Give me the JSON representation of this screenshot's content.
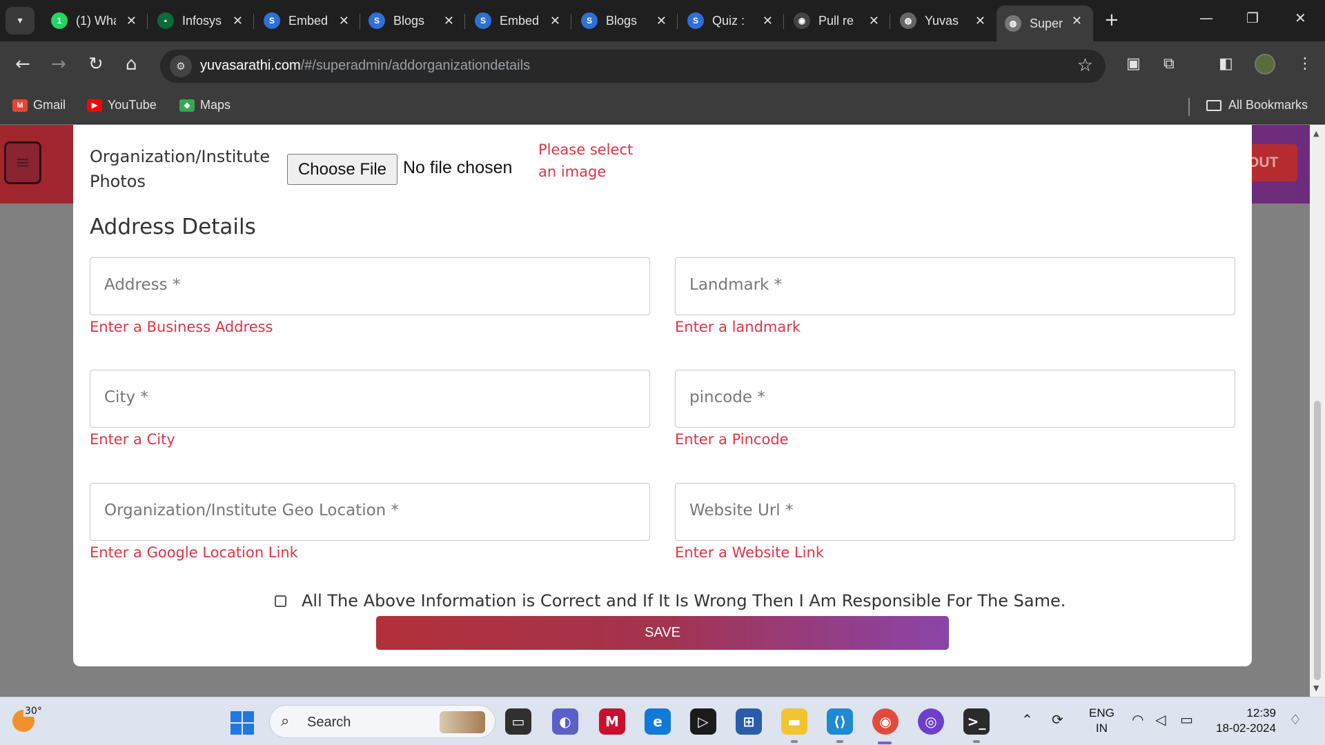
{
  "browser": {
    "tabs": [
      {
        "title": "(1) WhatsApp",
        "favicon": "whatsapp-icon",
        "color": "#25d366",
        "glyph": "1"
      },
      {
        "title": "Infosys",
        "favicon": "infosys-icon",
        "color": "#0b6b3a",
        "glyph": "▪"
      },
      {
        "title": "Embed",
        "favicon": "s-logo-icon",
        "color": "#2f6fd6",
        "glyph": "S"
      },
      {
        "title": "Blogs",
        "favicon": "s-logo-icon",
        "color": "#2f6fd6",
        "glyph": "S"
      },
      {
        "title": "Embed",
        "favicon": "s-logo-icon",
        "color": "#2f6fd6",
        "glyph": "S"
      },
      {
        "title": "Blogs",
        "favicon": "s-logo-icon",
        "color": "#2f6fd6",
        "glyph": "S"
      },
      {
        "title": "Quiz :",
        "favicon": "s-logo-icon",
        "color": "#2f6fd6",
        "glyph": "S"
      },
      {
        "title": "Pull re",
        "favicon": "github-icon",
        "color": "#444444",
        "glyph": "◉"
      },
      {
        "title": "Yuvas",
        "favicon": "globe-icon",
        "color": "#666666",
        "glyph": "◍"
      },
      {
        "title": "Super",
        "favicon": "globe-icon",
        "color": "#777777",
        "glyph": "◍"
      }
    ],
    "url_domain": "yuvasarathi.com",
    "url_path": "/#/superadmin/addorganizationdetails",
    "bookmarks": [
      {
        "label": "Gmail",
        "icon": "gmail-icon",
        "color": "#ea4335",
        "glyph": "M"
      },
      {
        "label": "YouTube",
        "icon": "youtube-icon",
        "color": "#ff0000",
        "glyph": "▶"
      },
      {
        "label": "Maps",
        "icon": "maps-icon",
        "color": "#34a853",
        "glyph": "◆"
      }
    ],
    "all_bookmarks": "All Bookmarks"
  },
  "page": {
    "logout_label": "OUT",
    "photos_label": "Organization/Institute Photos",
    "choose_file_label": "Choose File",
    "file_status": "No file chosen",
    "image_error": "Please select an image",
    "section_title": "Address Details",
    "fields": [
      {
        "placeholder": "Address *",
        "error": "Enter a Business Address"
      },
      {
        "placeholder": "Landmark *",
        "error": "Enter a landmark"
      },
      {
        "placeholder": "City *",
        "error": "Enter a City"
      },
      {
        "placeholder": "pincode *",
        "error": "Enter a Pincode"
      },
      {
        "placeholder": "Organization/Institute Geo Location *",
        "error": "Enter a Google Location Link"
      },
      {
        "placeholder": "Website Url *",
        "error": "Enter a Website Link"
      }
    ],
    "agreement": "All The Above Information is Correct and If It Is Wrong Then I Am Responsible For The Same.",
    "save_label": "SAVE"
  },
  "taskbar": {
    "temperature": "30°",
    "search_label": "Search",
    "lang_line1": "ENG",
    "lang_line2": "IN",
    "time": "12:39",
    "date": "18-02-2024"
  },
  "colors": {
    "accent_red": "#dc3545",
    "header_gradient_start": "#a3262d",
    "header_gradient_end": "#6b2c7f"
  }
}
